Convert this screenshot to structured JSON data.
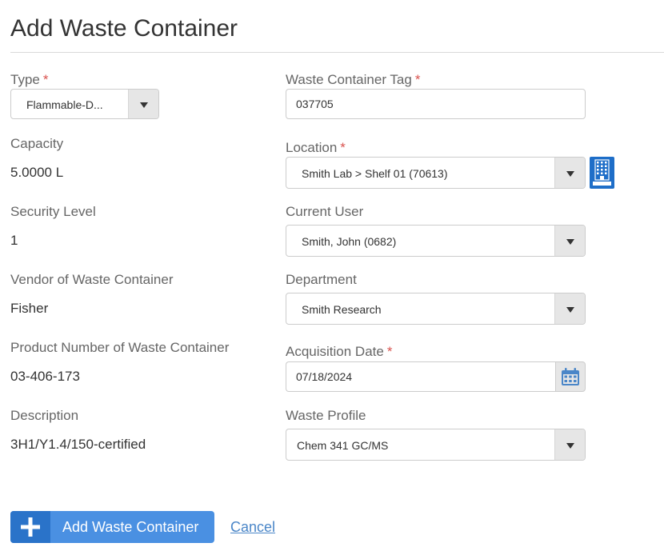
{
  "page": {
    "title": "Add Waste Container"
  },
  "left": {
    "type": {
      "label": "Type",
      "value": "Flammable-D..."
    },
    "capacity": {
      "label": "Capacity",
      "value": "5.0000 L"
    },
    "security_level": {
      "label": "Security Level",
      "value": "1"
    },
    "vendor": {
      "label": "Vendor of Waste Container",
      "value": "Fisher"
    },
    "product_number": {
      "label": "Product Number of Waste Container",
      "value": "03-406-173"
    },
    "description": {
      "label": "Description",
      "value": "3H1/Y1.4/150-certified"
    }
  },
  "right": {
    "tag": {
      "label": "Waste Container Tag",
      "value": "037705"
    },
    "location": {
      "label": "Location",
      "value": "Smith Lab > Shelf 01 (70613)"
    },
    "current_user": {
      "label": "Current User",
      "value": "Smith, John (0682)"
    },
    "department": {
      "label": "Department",
      "value": "Smith Research"
    },
    "acquisition_date": {
      "label": "Acquisition Date",
      "value": "07/18/2024"
    },
    "waste_profile": {
      "label": "Waste Profile",
      "value": "Chem 341 GC/MS"
    }
  },
  "required_mark": "*",
  "actions": {
    "add_label": "Add Waste Container",
    "cancel_label": "Cancel"
  },
  "colors": {
    "primary": "#4a90e2",
    "primary_dark": "#2a73c9",
    "required": "#d9534f",
    "link": "#4a86c8",
    "location_icon_bg": "#1e6ec8"
  },
  "icons": {
    "dropdown": "chevron-down-icon",
    "calendar": "calendar-icon",
    "location_picker": "building-icon",
    "add": "plus-icon"
  }
}
